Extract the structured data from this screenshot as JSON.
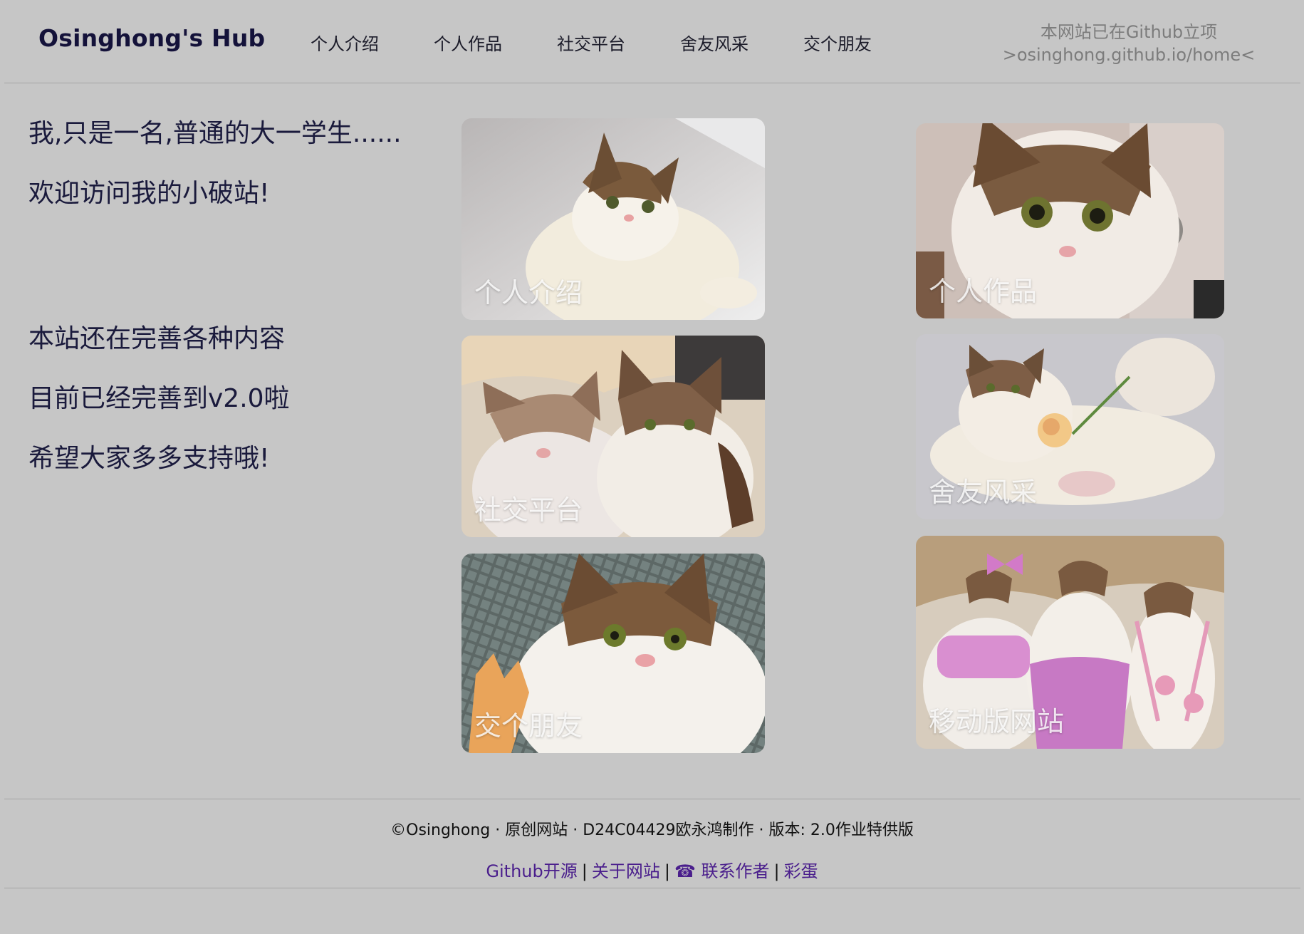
{
  "header": {
    "brand": "Osinghong's Hub",
    "nav": [
      "个人介绍",
      "个人作品",
      "社交平台",
      "舍友风采",
      "交个朋友"
    ],
    "notice_line1": "本网站已在Github立项",
    "notice_line2": ">osinghong.github.io/home<"
  },
  "intro": {
    "line1": "我,只是一名,普通的大一学生......",
    "line2": "欢迎访问我的小破站!",
    "line3": "本站还在完善各种内容",
    "line4": "目前已经完善到v2.0啦",
    "line5": "希望大家多多支持哦!"
  },
  "cards": {
    "intro": "个人介绍",
    "works": "个人作品",
    "social": "社交平台",
    "roommates": "舍友风采",
    "friends": "交个朋友",
    "mobile": "移动版网站"
  },
  "footer": {
    "copyright": "©Osinghong · 原创网站 · D24C04429欧永鸿制作 · 版本: 2.0作业特供版",
    "links": {
      "github": "Github开源",
      "about": "关于网站",
      "contact_icon": "☎",
      "contact": "联系作者",
      "easter_egg": "彩蛋"
    },
    "separator": "|"
  },
  "colors": {
    "background": "#c6c6c6",
    "brand": "#14123a",
    "notice": "#7c7c7c",
    "link": "#4a1e8c"
  }
}
